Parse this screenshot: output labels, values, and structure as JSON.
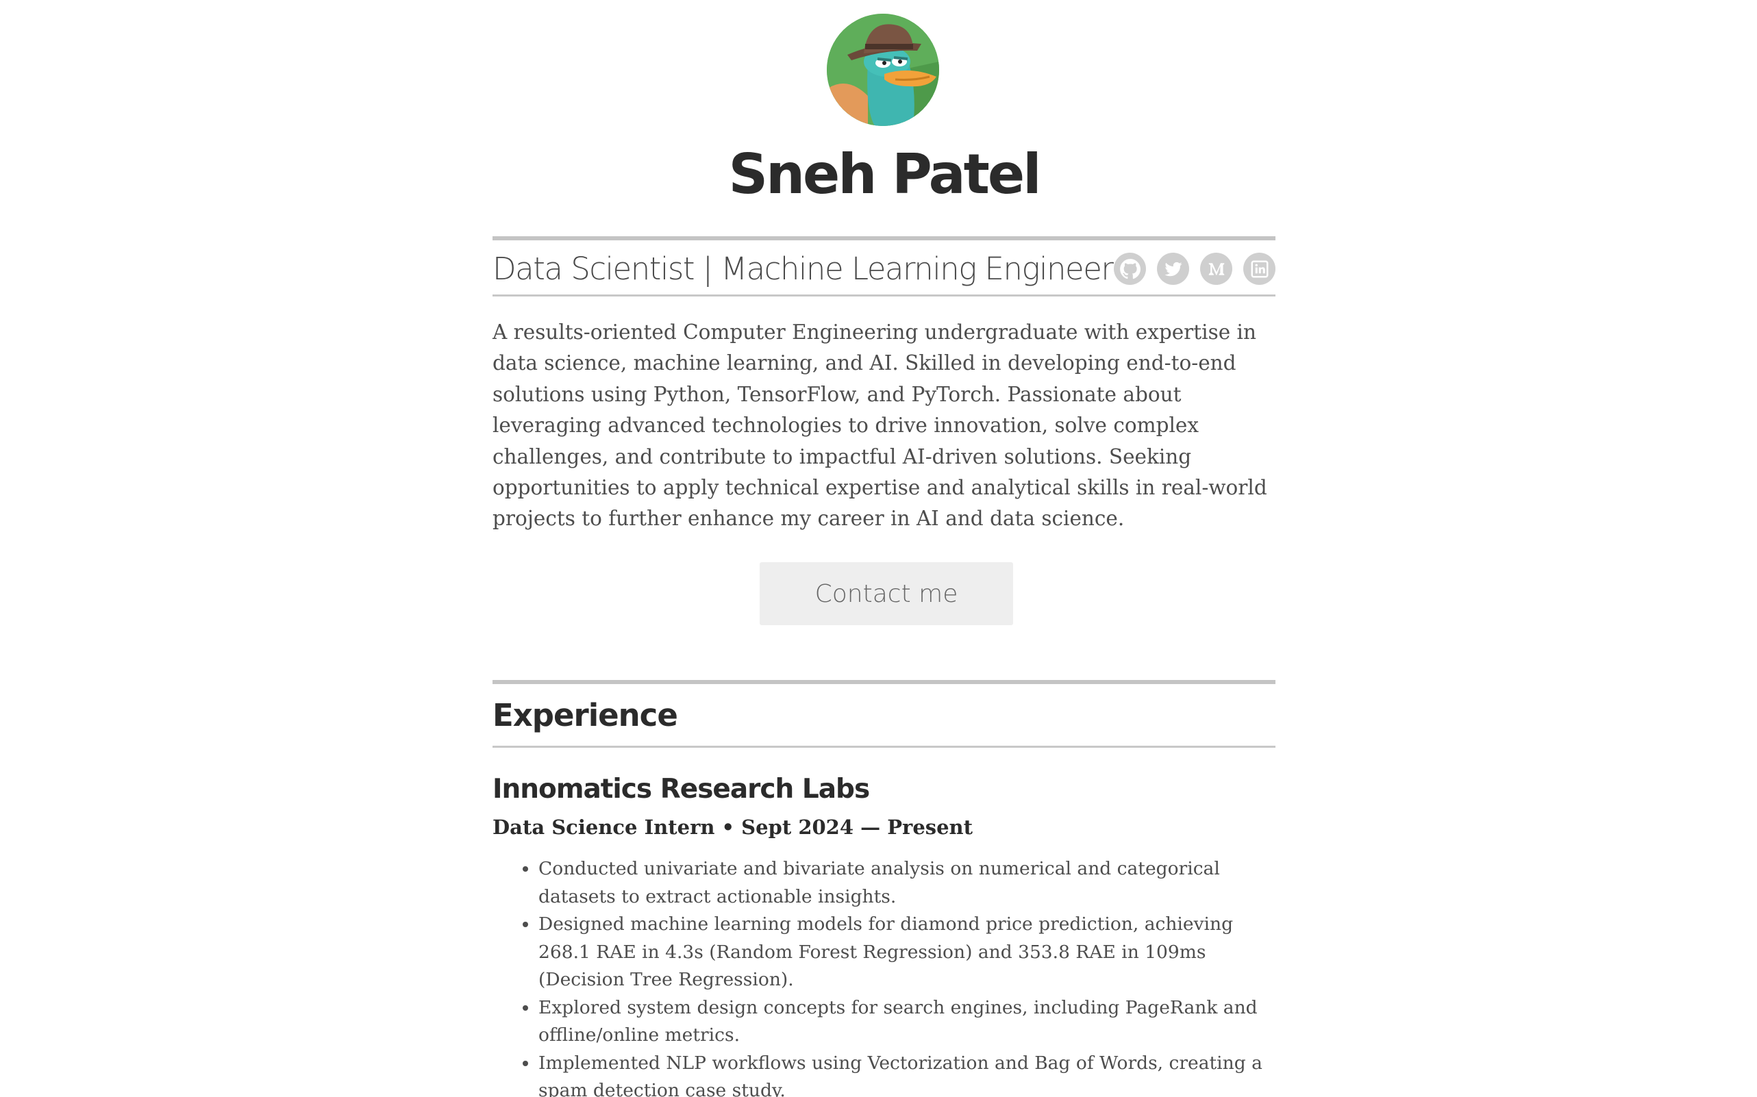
{
  "header": {
    "name": "Sneh Patel",
    "tagline": "Data Scientist | Machine Learning Engineer",
    "social_icons": [
      "github-icon",
      "twitter-icon",
      "medium-icon",
      "linkedin-icon"
    ]
  },
  "summary": "A results-oriented Computer Engineering undergraduate with expertise in data science, machine learning, and AI. Skilled in developing end-to-end solutions using Python, TensorFlow, and PyTorch. Passionate about leveraging advanced technologies to drive innovation, solve complex challenges, and contribute to impactful AI-driven solutions. Seeking opportunities to apply technical expertise and analytical skills in real-world projects to further enhance my career in AI and data science.",
  "contact_label": "Contact me",
  "experience": {
    "title": "Experience",
    "jobs": [
      {
        "company": "Innomatics Research Labs",
        "role": "Data Science Intern • Sept 2024 — Present",
        "bullets": [
          "Conducted univariate and bivariate analysis on numerical and categorical datasets to extract actionable insights.",
          "Designed machine learning models for diamond price prediction, achieving 268.1 RAE in 4.3s (Random Forest Regression) and 353.8 RAE in 109ms (Decision Tree Regression).",
          "Explored system design concepts for search engines, including PageRank and offline/online metrics.",
          "Implemented NLP workflows using Vectorization and Bag of Words, creating a spam detection case study."
        ]
      }
    ]
  },
  "colors": {
    "text_dark": "#2b2b2b",
    "text_body": "#4d4d4d",
    "rule": "#c4c4c4",
    "icon_bg": "#cfcfcf",
    "button_bg": "#eeeeee"
  }
}
